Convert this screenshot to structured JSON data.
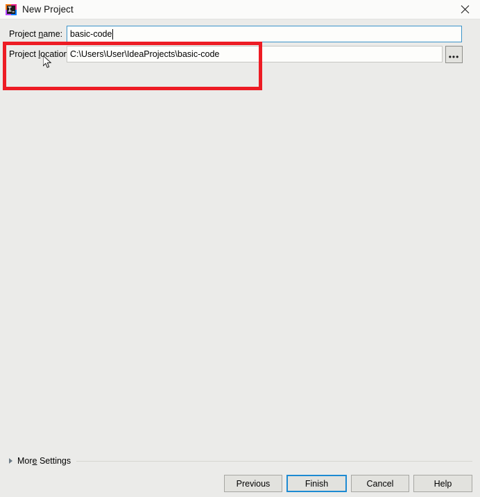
{
  "window": {
    "title": "New Project",
    "app_icon": "intellij-idea-icon",
    "close_label": "✕"
  },
  "form": {
    "name_field": {
      "label_pre": "Project ",
      "label_mnemonic": "n",
      "label_post": "ame:",
      "value": "basic-code",
      "placeholder": ""
    },
    "location_field": {
      "label_pre": "Project ",
      "label_mnemonic": "l",
      "label_post": "ocation:",
      "value": "C:\\Users\\User\\IdeaProjects\\basic-code",
      "placeholder": "",
      "browse_label": "•••"
    }
  },
  "annotation": {
    "color": "#ed1c24",
    "shape": "rectangle"
  },
  "more_settings": {
    "label_pre": "Mor",
    "label_mnemonic": "e",
    "label_post": " Settings"
  },
  "buttons": {
    "previous": "Previous",
    "finish": "Finish",
    "cancel": "Cancel",
    "help": "Help"
  },
  "colors": {
    "accent_focus": "#1d8ad2",
    "annotation": "#ed1c24",
    "dialog_bg": "#ebebe9",
    "titlebar_bg": "#fbfbfa"
  }
}
